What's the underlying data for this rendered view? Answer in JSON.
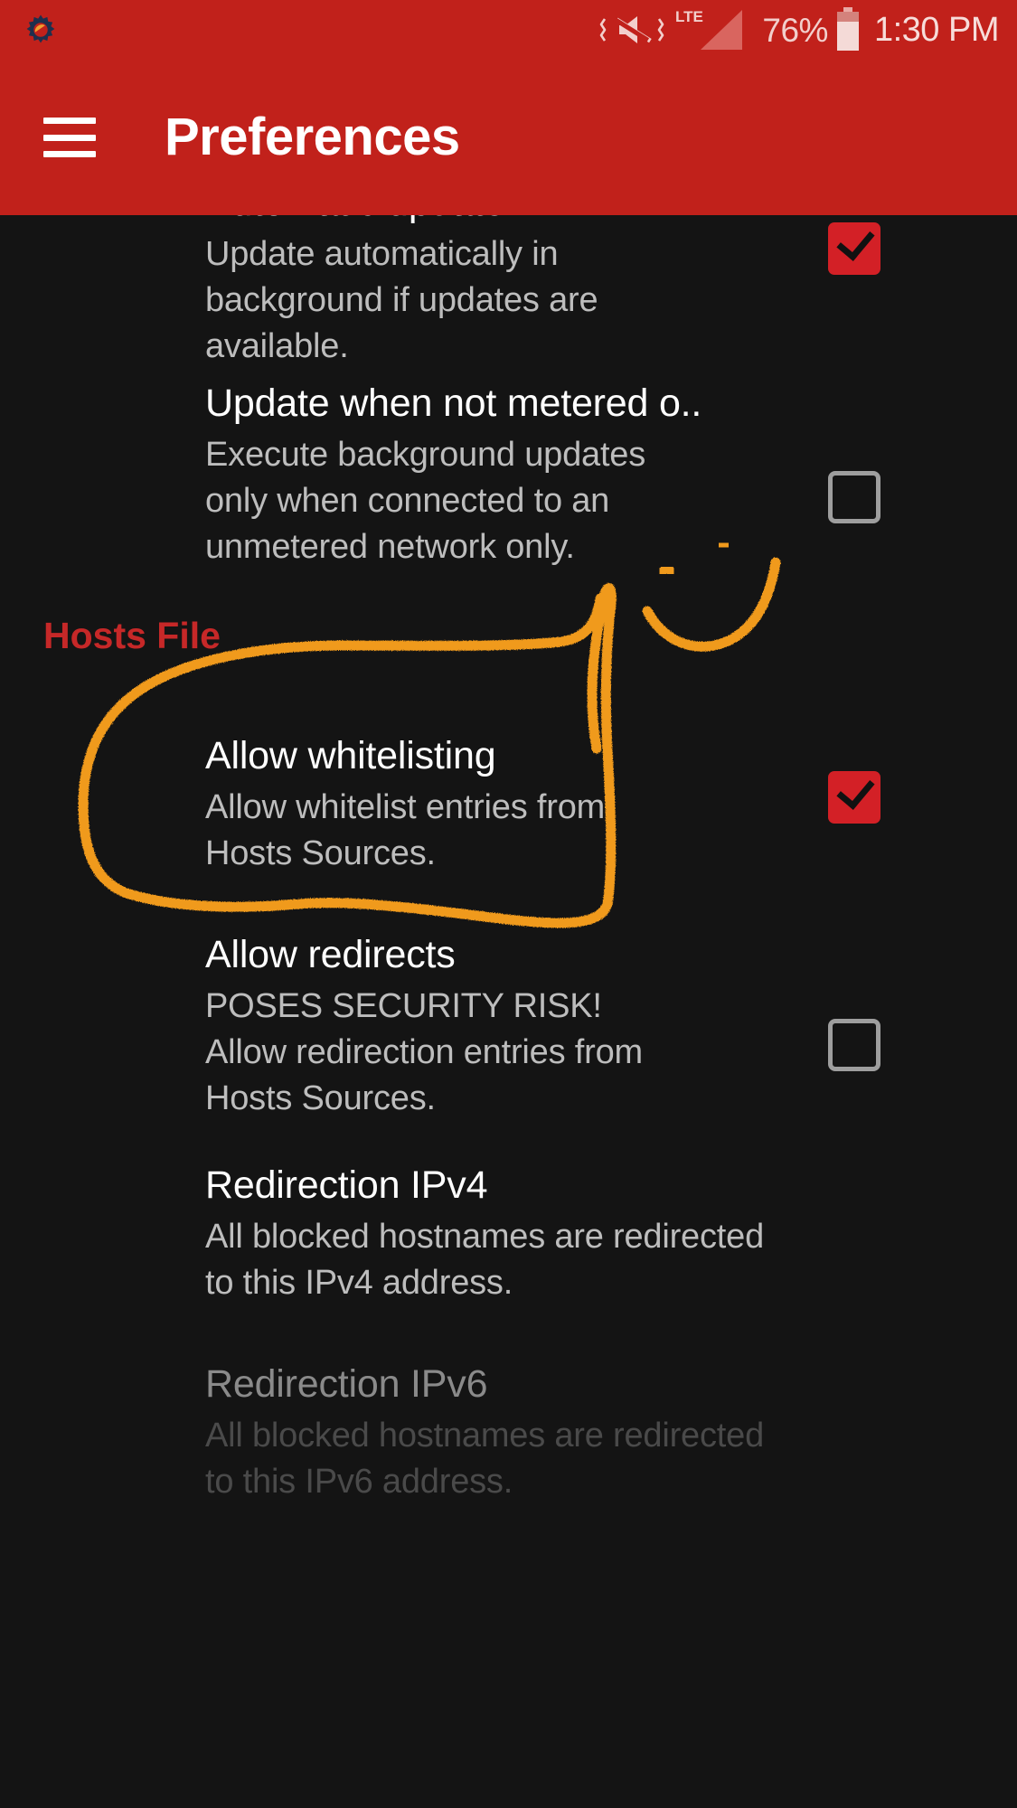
{
  "statusbar": {
    "app_icon": "gear-icon",
    "vibrate_mute_icon": "volume-mute-vibrate-icon",
    "network_type": "LTE",
    "signal_icon": "signal-bars-icon",
    "battery_percent": "76%",
    "battery_icon": "battery-icon",
    "clock": "1:30 PM"
  },
  "appbar": {
    "menu_icon": "hamburger-menu-icon",
    "title": "Preferences",
    "background_color": "#c1211b"
  },
  "theme": {
    "page_background": "#141414",
    "accent_red": "#d32026",
    "section_header_red": "#c62828",
    "annotation_orange": "#f09a1e",
    "primary_text": "#ffffff",
    "secondary_text": "#bdbdbd",
    "disabled_text": "#8a8a8a"
  },
  "preferences": [
    {
      "title": "Automatic update",
      "summary": "Update automatically in background if updates are available.",
      "widget": "checkbox",
      "checked": true,
      "clipped_title": true,
      "disabled": false
    },
    {
      "title": "Update when not metered o..",
      "summary": "Execute background updates only when connected to an unmetered network only.",
      "widget": "checkbox",
      "checked": false,
      "clipped_title": false,
      "disabled": false
    },
    {
      "title": "Allow whitelisting",
      "summary": "Allow whitelist entries from Hosts Sources.",
      "widget": "checkbox",
      "checked": true,
      "clipped_title": false,
      "disabled": false,
      "annotated": true
    },
    {
      "title": "Allow redirects",
      "summary": "POSES SECURITY RISK! Allow redirection entries from Hosts Sources.",
      "widget": "checkbox",
      "checked": false,
      "clipped_title": false,
      "disabled": false
    },
    {
      "title": "Redirection IPv4",
      "summary": "All blocked hostnames are redirected to this IPv4 address.",
      "widget": "none",
      "checked": false,
      "clipped_title": false,
      "disabled": false
    },
    {
      "title": "Redirection IPv6",
      "summary": "All blocked hostnames are redirected to this IPv6 address.",
      "widget": "none",
      "checked": false,
      "clipped_title": false,
      "disabled": true
    }
  ],
  "sections": [
    {
      "label": "Hosts File"
    }
  ],
  "annotation": {
    "type": "hand-drawn-highlight",
    "color": "#f09a1e",
    "shapes": [
      "circle-around-allow-whitelisting",
      "arc-mark",
      "dot-mark",
      "dot-mark"
    ],
    "target": "Allow whitelisting"
  }
}
